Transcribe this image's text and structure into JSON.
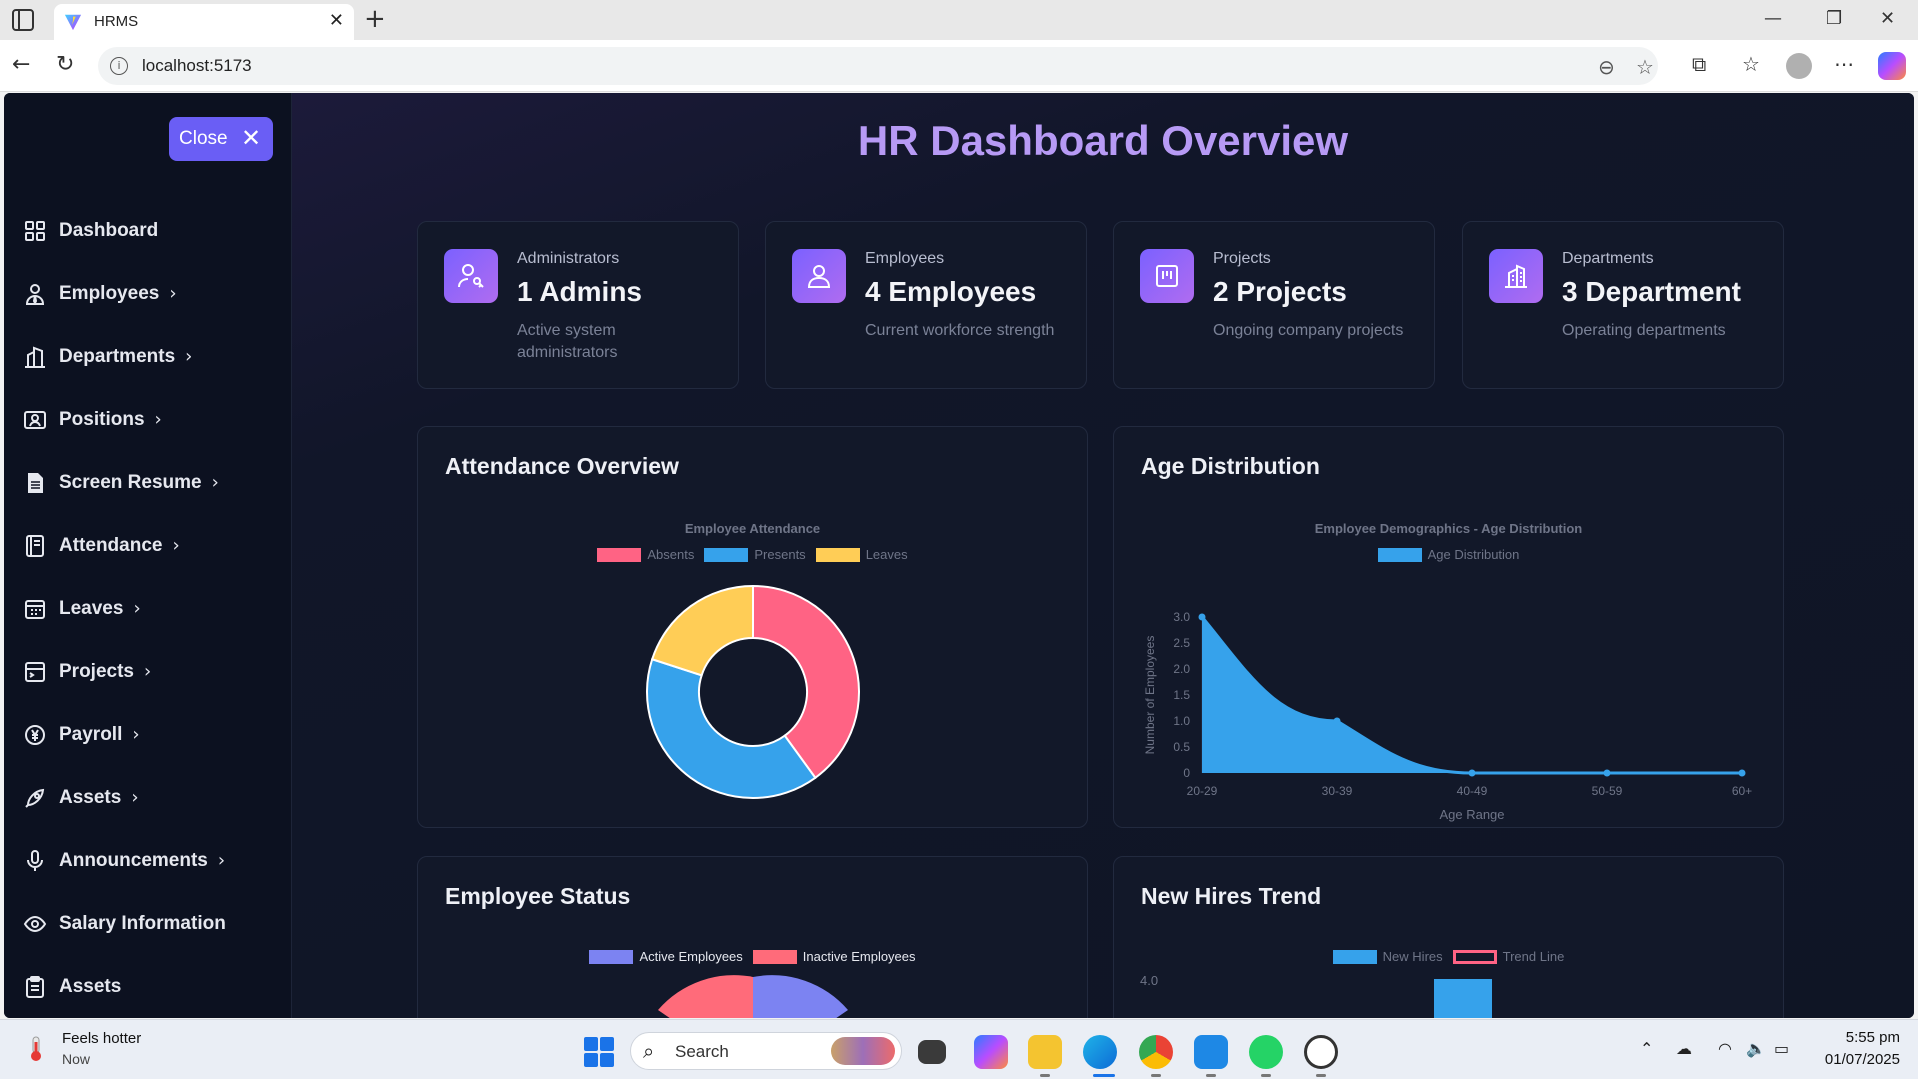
{
  "browser": {
    "tab_title": "HRMS",
    "url": "localhost:5173"
  },
  "sidebar": {
    "close_label": "Close",
    "items": [
      {
        "label": "Dashboard",
        "icon": "grid-icon",
        "chevron": false
      },
      {
        "label": "Employees",
        "icon": "user-tie-icon",
        "chevron": true
      },
      {
        "label": "Departments",
        "icon": "building-icon",
        "chevron": true
      },
      {
        "label": "Positions",
        "icon": "id-card-icon",
        "chevron": true
      },
      {
        "label": "Screen Resume",
        "icon": "document-icon",
        "chevron": true
      },
      {
        "label": "Attendance",
        "icon": "notebook-icon",
        "chevron": true
      },
      {
        "label": "Leaves",
        "icon": "calendar-icon",
        "chevron": true
      },
      {
        "label": "Projects",
        "icon": "project-icon",
        "chevron": true
      },
      {
        "label": "Payroll",
        "icon": "currency-icon",
        "chevron": true
      },
      {
        "label": "Assets",
        "icon": "rocket-icon",
        "chevron": true
      },
      {
        "label": "Announcements",
        "icon": "microphone-icon",
        "chevron": true
      },
      {
        "label": "Salary Information",
        "icon": "eye-money-icon",
        "chevron": false
      },
      {
        "label": "Assets",
        "icon": "clipboard-icon",
        "chevron": false
      }
    ]
  },
  "dashboard": {
    "title": "HR Dashboard Overview",
    "cards": [
      {
        "caption": "Administrators",
        "value": "1 Admins",
        "description": "Active system administrators",
        "icon": "admin-key-icon"
      },
      {
        "caption": "Employees",
        "value": "4 Employees",
        "description": "Current workforce strength",
        "icon": "user-icon"
      },
      {
        "caption": "Projects",
        "value": "2 Projects",
        "description": "Ongoing company projects",
        "icon": "kanban-icon"
      },
      {
        "caption": "Departments",
        "value": "3 Department",
        "description": "Operating departments",
        "icon": "office-building-icon"
      }
    ],
    "panels": {
      "attendance": "Attendance Overview",
      "age": "Age Distribution",
      "status": "Employee Status",
      "hires": "New Hires Trend"
    }
  },
  "chart_data": [
    {
      "type": "pie",
      "title": "Employee Attendance",
      "categories": [
        "Absents",
        "Presents",
        "Leaves"
      ],
      "values": [
        40,
        40,
        20
      ],
      "colors": [
        "#ff6384",
        "#36a2eb",
        "#ffcd56"
      ],
      "legend": "top"
    },
    {
      "type": "area",
      "title": "Employee Demographics - Age Distribution",
      "series": [
        {
          "name": "Age Distribution",
          "values": [
            3,
            1,
            0,
            0,
            0
          ]
        }
      ],
      "categories": [
        "20-29",
        "30-39",
        "40-49",
        "50-59",
        "60+"
      ],
      "xlabel": "Age Range",
      "ylabel": "Number of Employees",
      "ylim": [
        0,
        3
      ],
      "yticks": [
        "3.0",
        "2.5",
        "2.0",
        "1.5",
        "1.0",
        "0.5",
        "0"
      ],
      "color": "#36a2eb",
      "legend": "top"
    },
    {
      "type": "pie",
      "categories": [
        "Active Employees",
        "Inactive Employees"
      ],
      "colors": [
        "#7c83f2",
        "#ff6b7a"
      ],
      "legend": "top"
    },
    {
      "type": "bar",
      "series": [
        {
          "name": "New Hires"
        },
        {
          "name": "Trend Line"
        }
      ],
      "colors": [
        "#36a2eb",
        "#ff6384"
      ],
      "yticks": [
        "4.0"
      ],
      "legend": "top"
    }
  ],
  "taskbar": {
    "weather_title": "Feels hotter",
    "weather_sub": "Now",
    "search_label": "Search",
    "time": "5:55 pm",
    "date": "01/07/2025"
  }
}
